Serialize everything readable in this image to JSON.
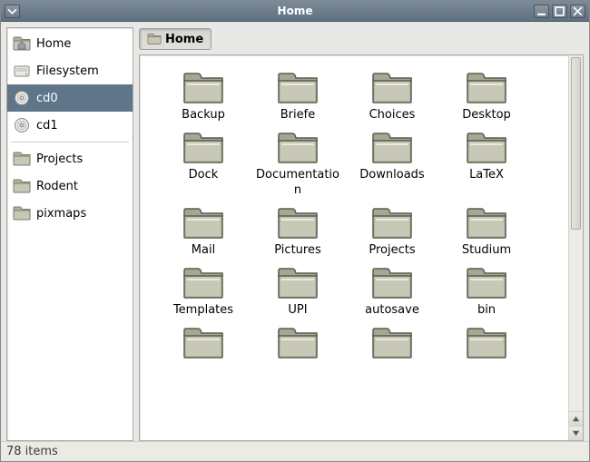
{
  "window": {
    "title": "Home"
  },
  "sidebar": {
    "places": [
      {
        "label": "Home",
        "icon": "home"
      },
      {
        "label": "Filesystem",
        "icon": "drive"
      },
      {
        "label": "cd0",
        "icon": "disc",
        "selected": true
      },
      {
        "label": "cd1",
        "icon": "disc"
      }
    ],
    "bookmarks": [
      {
        "label": "Projects",
        "icon": "folder"
      },
      {
        "label": "Rodent",
        "icon": "folder"
      },
      {
        "label": "pixmaps",
        "icon": "folder"
      }
    ]
  },
  "pathbar": {
    "segments": [
      {
        "label": "Home",
        "icon": "folder",
        "active": true
      }
    ]
  },
  "folders": [
    "Backup",
    "Briefe",
    "Choices",
    "Desktop",
    "Dock",
    "Documentation",
    "Downloads",
    "LaTeX",
    "Mail",
    "Pictures",
    "Projects",
    "Studium",
    "Templates",
    "UPI",
    "autosave",
    "bin"
  ],
  "status": {
    "items_text": "78 items"
  }
}
